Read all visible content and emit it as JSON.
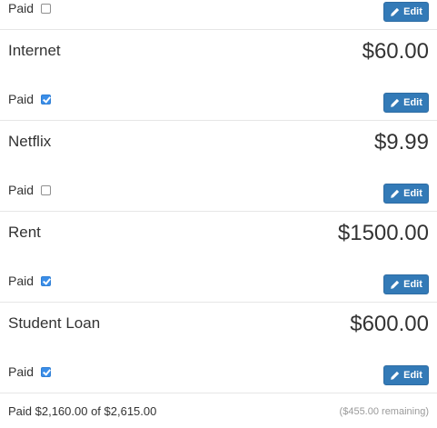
{
  "bills": [
    {
      "name": "",
      "amount": "",
      "paid_label": "Paid",
      "paid": false,
      "edit_label": "Edit"
    },
    {
      "name": "Internet",
      "amount": "$60.00",
      "paid_label": "Paid",
      "paid": true,
      "edit_label": "Edit"
    },
    {
      "name": "Netflix",
      "amount": "$9.99",
      "paid_label": "Paid",
      "paid": false,
      "edit_label": "Edit"
    },
    {
      "name": "Rent",
      "amount": "$1500.00",
      "paid_label": "Paid",
      "paid": true,
      "edit_label": "Edit"
    },
    {
      "name": "Student Loan",
      "amount": "$600.00",
      "paid_label": "Paid",
      "paid": true,
      "edit_label": "Edit"
    }
  ],
  "summary": {
    "paid_text": "Paid $2,160.00 of $2,615.00",
    "remaining_text": "($455.00 remaining)"
  },
  "icons": {
    "edit": "pencil-icon"
  },
  "colors": {
    "button": "#337ab7",
    "checkbox_checked": "#3b8ee8",
    "muted_text": "#9a9a9a"
  }
}
